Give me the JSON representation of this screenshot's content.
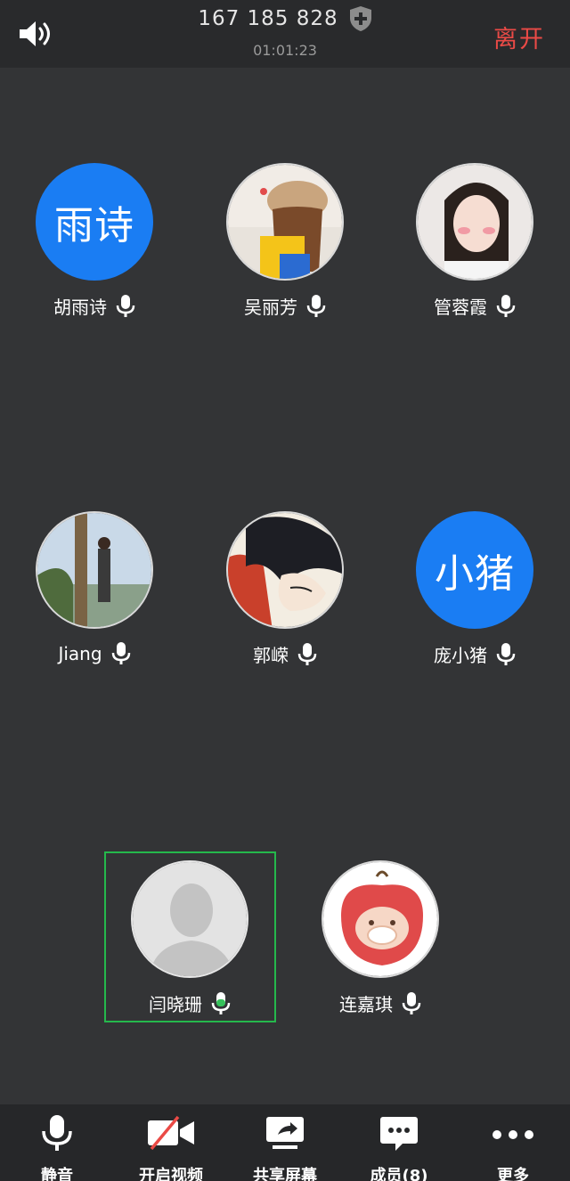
{
  "header": {
    "meeting_id": "167 185 828",
    "timer": "01:01:23",
    "leave_label": "离开"
  },
  "participants": [
    {
      "name": "胡雨诗",
      "avatar_text": "雨诗",
      "avatar_type": "text",
      "mic": "on"
    },
    {
      "name": "吴丽芳",
      "avatar_type": "photo",
      "mic": "on"
    },
    {
      "name": "管蓉霞",
      "avatar_type": "photo",
      "mic": "on"
    },
    {
      "name": "Jiang",
      "avatar_type": "photo",
      "mic": "on"
    },
    {
      "name": "郭嵘",
      "avatar_type": "photo",
      "mic": "on"
    },
    {
      "name": "庞小猪",
      "avatar_text": "小猪",
      "avatar_type": "text",
      "mic": "on"
    },
    {
      "name": "闫晓珊",
      "avatar_type": "default",
      "mic": "speaking",
      "selected": true
    },
    {
      "name": "连嘉琪",
      "avatar_type": "photo",
      "mic": "on"
    }
  ],
  "toolbar": {
    "mute_label": "静音",
    "video_label": "开启视频",
    "share_label": "共享屏幕",
    "members_label": "成员(8)",
    "more_label": "更多"
  },
  "colors": {
    "background": "#333436",
    "accent_blue": "#1a7df3",
    "leave_red": "#ea4a46",
    "speaking_green": "#25b84c"
  }
}
